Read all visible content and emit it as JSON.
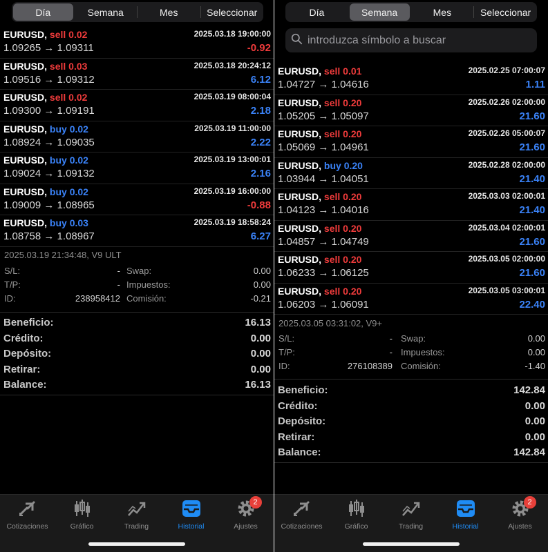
{
  "colors": {
    "sell": "#ef3b3b",
    "buy": "#3a82f7",
    "active_tab": "#1f8cf5",
    "badge": "#e8403a"
  },
  "left": {
    "segments": [
      {
        "label": "Día",
        "active": true
      },
      {
        "label": "Semana",
        "active": false
      },
      {
        "label": "Mes",
        "active": false
      },
      {
        "label": "Seleccionar",
        "active": false
      }
    ],
    "trades": [
      {
        "symbol": "EURUSD,",
        "side": "sell",
        "lots": "0.02",
        "time": "2025.03.18 19:00:00",
        "prices": "1.09265 → 1.09311",
        "profit": "-0.92"
      },
      {
        "symbol": "EURUSD,",
        "side": "sell",
        "lots": "0.03",
        "time": "2025.03.18 20:24:12",
        "prices": "1.09516 → 1.09312",
        "profit": "6.12"
      },
      {
        "symbol": "EURUSD,",
        "side": "sell",
        "lots": "0.02",
        "time": "2025.03.19 08:00:04",
        "prices": "1.09300 → 1.09191",
        "profit": "2.18"
      },
      {
        "symbol": "EURUSD,",
        "side": "buy",
        "lots": "0.02",
        "time": "2025.03.19 11:00:00",
        "prices": "1.08924 → 1.09035",
        "profit": "2.22"
      },
      {
        "symbol": "EURUSD,",
        "side": "buy",
        "lots": "0.02",
        "time": "2025.03.19 13:00:01",
        "prices": "1.09024 → 1.09132",
        "profit": "2.16"
      },
      {
        "symbol": "EURUSD,",
        "side": "buy",
        "lots": "0.02",
        "time": "2025.03.19 16:00:00",
        "prices": "1.09009 → 1.08965",
        "profit": "-0.88"
      },
      {
        "symbol": "EURUSD,",
        "side": "buy",
        "lots": "0.03",
        "time": "2025.03.19 18:58:24",
        "prices": "1.08758 → 1.08967",
        "profit": "6.27"
      }
    ],
    "detail": {
      "stamp": "2025.03.19 21:34:48, V9 ULT",
      "sl_label": "S/L:",
      "sl_value": "-",
      "tp_label": "T/P:",
      "tp_value": "-",
      "id_label": "ID:",
      "id_value": "238958412",
      "swap_label": "Swap:",
      "swap_value": "0.00",
      "tax_label": "Impuestos:",
      "tax_value": "0.00",
      "commission_label": "Comisión:",
      "commission_value": "-0.21"
    },
    "summary": [
      {
        "label": "Beneficio:",
        "value": "16.13"
      },
      {
        "label": "Crédito:",
        "value": "0.00"
      },
      {
        "label": "Depósito:",
        "value": "0.00"
      },
      {
        "label": "Retirar:",
        "value": "0.00"
      },
      {
        "label": "Balance:",
        "value": "16.13"
      }
    ]
  },
  "right": {
    "segments": [
      {
        "label": "Día",
        "active": false
      },
      {
        "label": "Semana",
        "active": true
      },
      {
        "label": "Mes",
        "active": false
      },
      {
        "label": "Seleccionar",
        "active": false
      }
    ],
    "search": {
      "placeholder": "introduzca símbolo a buscar"
    },
    "trades": [
      {
        "symbol": "EURUSD,",
        "side": "sell",
        "lots": "0.01",
        "time": "2025.02.25 07:00:07",
        "prices": "1.04727 → 1.04616",
        "profit": "1.11"
      },
      {
        "symbol": "EURUSD,",
        "side": "sell",
        "lots": "0.20",
        "time": "2025.02.26 02:00:00",
        "prices": "1.05205 → 1.05097",
        "profit": "21.60"
      },
      {
        "symbol": "EURUSD,",
        "side": "sell",
        "lots": "0.20",
        "time": "2025.02.26 05:00:07",
        "prices": "1.05069 → 1.04961",
        "profit": "21.60"
      },
      {
        "symbol": "EURUSD,",
        "side": "buy",
        "lots": "0.20",
        "time": "2025.02.28 02:00:00",
        "prices": "1.03944 → 1.04051",
        "profit": "21.40"
      },
      {
        "symbol": "EURUSD,",
        "side": "sell",
        "lots": "0.20",
        "time": "2025.03.03 02:00:01",
        "prices": "1.04123 → 1.04016",
        "profit": "21.40"
      },
      {
        "symbol": "EURUSD,",
        "side": "sell",
        "lots": "0.20",
        "time": "2025.03.04 02:00:01",
        "prices": "1.04857 → 1.04749",
        "profit": "21.60"
      },
      {
        "symbol": "EURUSD,",
        "side": "sell",
        "lots": "0.20",
        "time": "2025.03.05 02:00:00",
        "prices": "1.06233 → 1.06125",
        "profit": "21.60"
      },
      {
        "symbol": "EURUSD,",
        "side": "sell",
        "lots": "0.20",
        "time": "2025.03.05 03:00:01",
        "prices": "1.06203 → 1.06091",
        "profit": "22.40"
      }
    ],
    "detail": {
      "stamp": "2025.03.05 03:31:02, V9+",
      "sl_label": "S/L:",
      "sl_value": "-",
      "tp_label": "T/P:",
      "tp_value": "-",
      "id_label": "ID:",
      "id_value": "276108389",
      "swap_label": "Swap:",
      "swap_value": "0.00",
      "tax_label": "Impuestos:",
      "tax_value": "0.00",
      "commission_label": "Comisión:",
      "commission_value": "-1.40"
    },
    "summary": [
      {
        "label": "Beneficio:",
        "value": "142.84"
      },
      {
        "label": "Crédito:",
        "value": "0.00"
      },
      {
        "label": "Depósito:",
        "value": "0.00"
      },
      {
        "label": "Retirar:",
        "value": "0.00"
      },
      {
        "label": "Balance:",
        "value": "142.84"
      }
    ]
  },
  "tabbar": {
    "tabs": [
      {
        "label": "Cotizaciones",
        "icon": "arrows-icon",
        "active": false
      },
      {
        "label": "Gráfico",
        "icon": "candles-icon",
        "active": false
      },
      {
        "label": "Trading",
        "icon": "trading-icon",
        "active": false
      },
      {
        "label": "Historial",
        "icon": "inbox-icon",
        "active": true
      },
      {
        "label": "Ajustes",
        "icon": "gear-icon",
        "active": false,
        "badge": "2"
      }
    ]
  }
}
